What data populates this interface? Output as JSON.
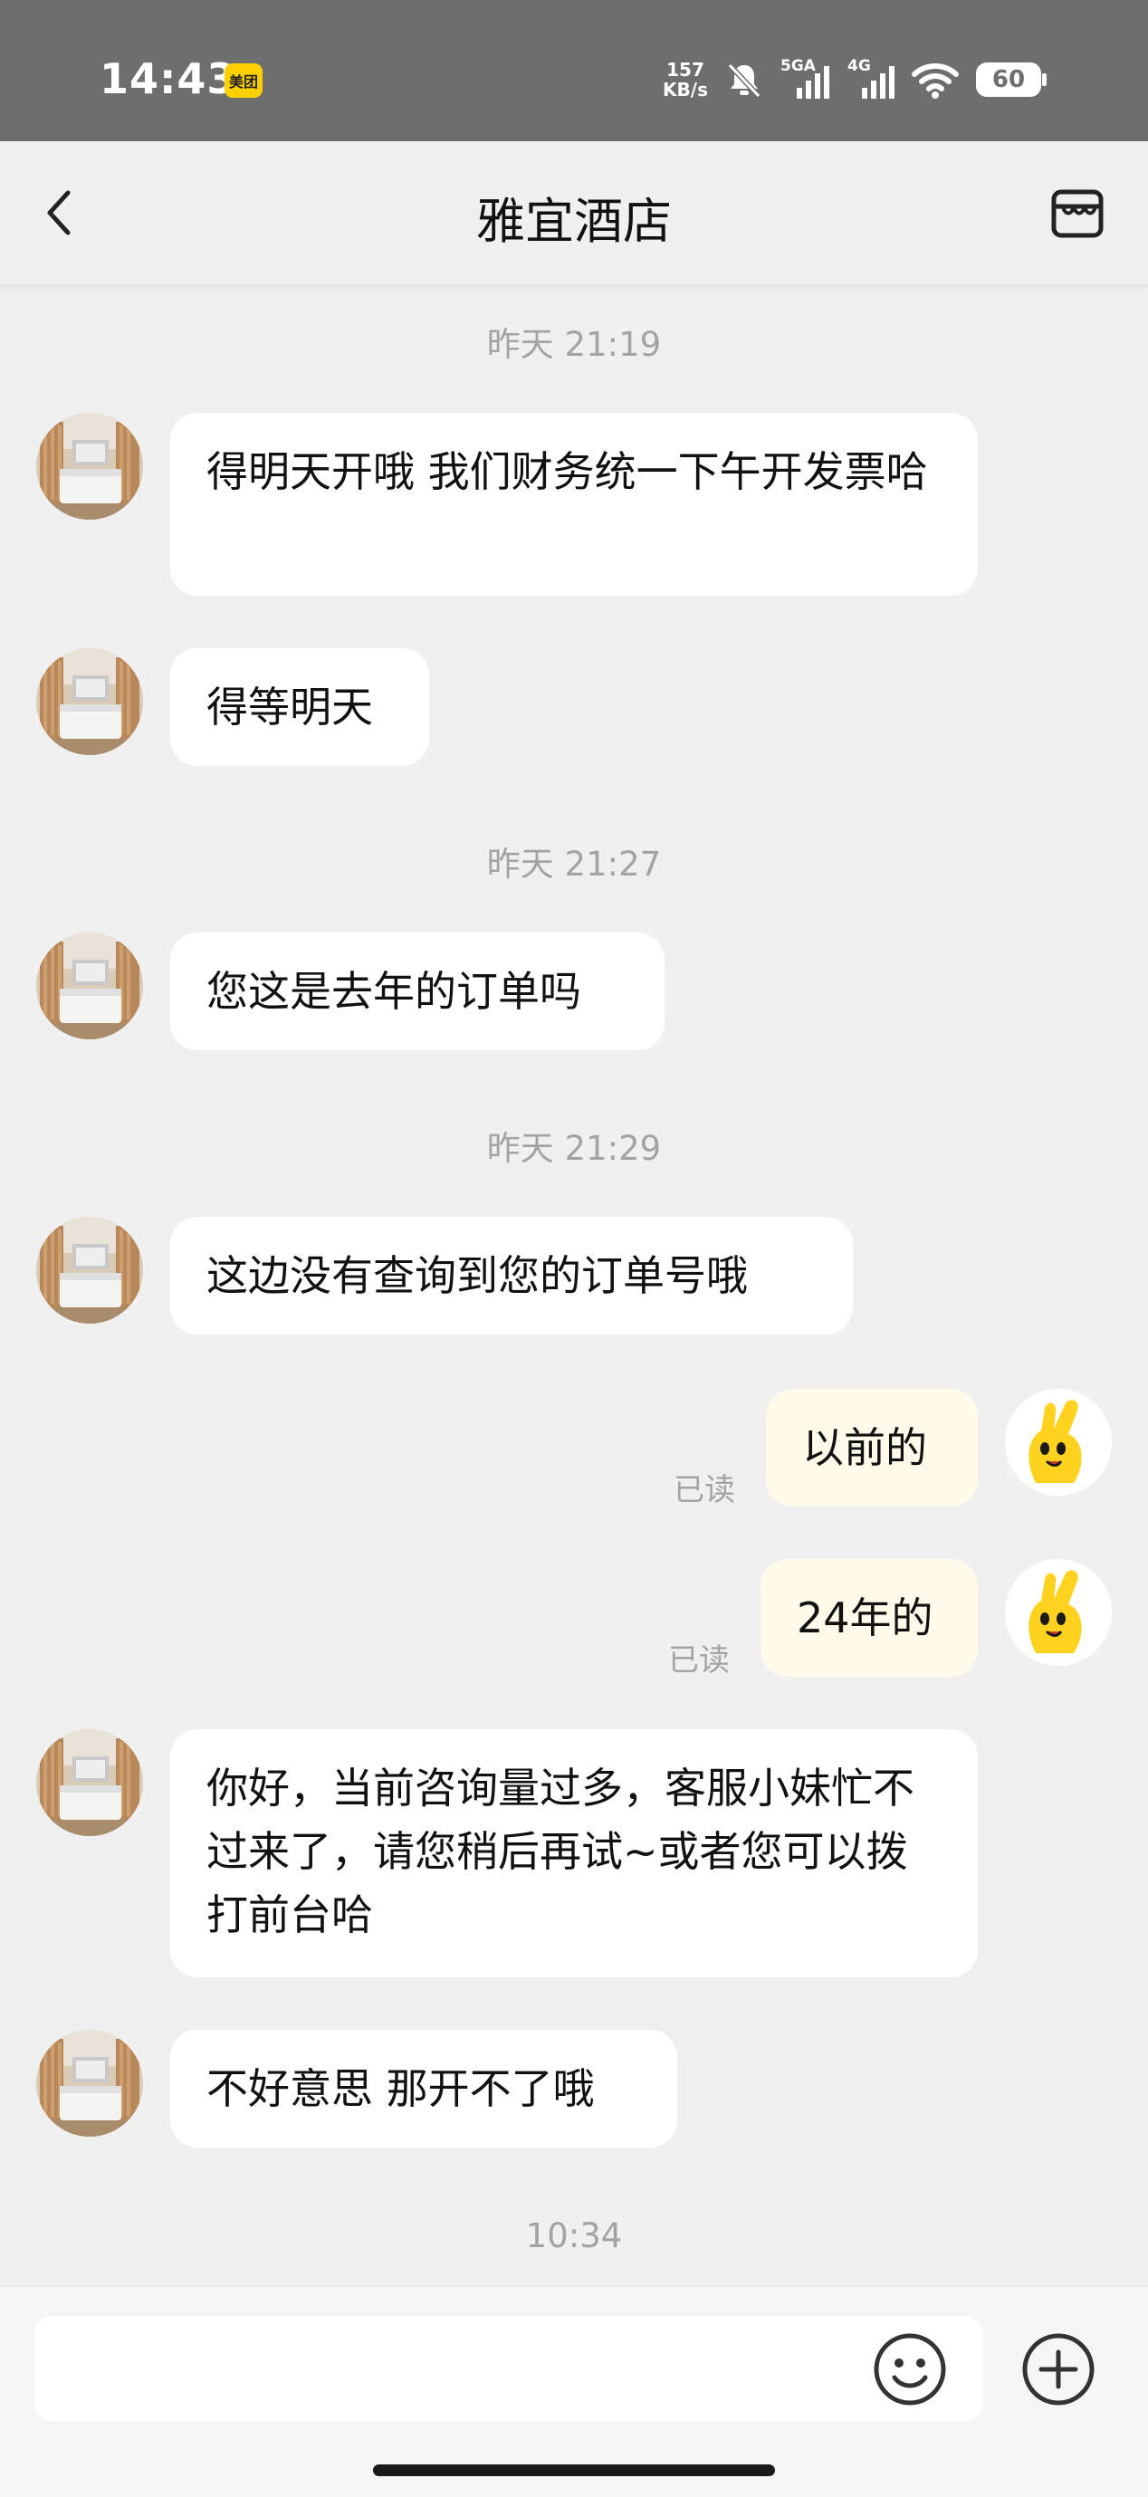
{
  "status_bar": {
    "time": "14:43",
    "app_badge": "美团",
    "net_speed_value": "157",
    "net_speed_unit": "KB/s",
    "net1_label": "5GA",
    "net2_label": "4G",
    "battery": "60"
  },
  "header": {
    "title": "雅宜酒店"
  },
  "chat": {
    "sep1": "昨天 21:19",
    "msg1": "得明天开哦 我们财务统一下午开发票哈",
    "msg2": "得等明天",
    "sep2": "昨天 21:27",
    "msg3": "您这是去年的订单吗",
    "sep3": "昨天 21:29",
    "msg4": "这边没有查询到您的订单号哦",
    "msg5": "以前的",
    "msg5_status": "已读",
    "msg6": "24年的",
    "msg6_status": "已读",
    "msg7": "你好，当前咨询量过多，客服小妹忙不过来了，请您稍后再试~或者您可以拨打前台哈",
    "msg8": "不好意思 那开不了哦",
    "sep4": "10:34"
  },
  "colors": {
    "outgoing_bubble": "#fffaea",
    "incoming_bubble": "#ffffff",
    "background": "#f0f0f0",
    "mascot_yellow": "#ffd21f"
  },
  "icons": [
    "back-icon",
    "shop-icon",
    "emoji-icon",
    "plus-icon",
    "mute-icon",
    "wifi-icon",
    "signal-icon"
  ]
}
